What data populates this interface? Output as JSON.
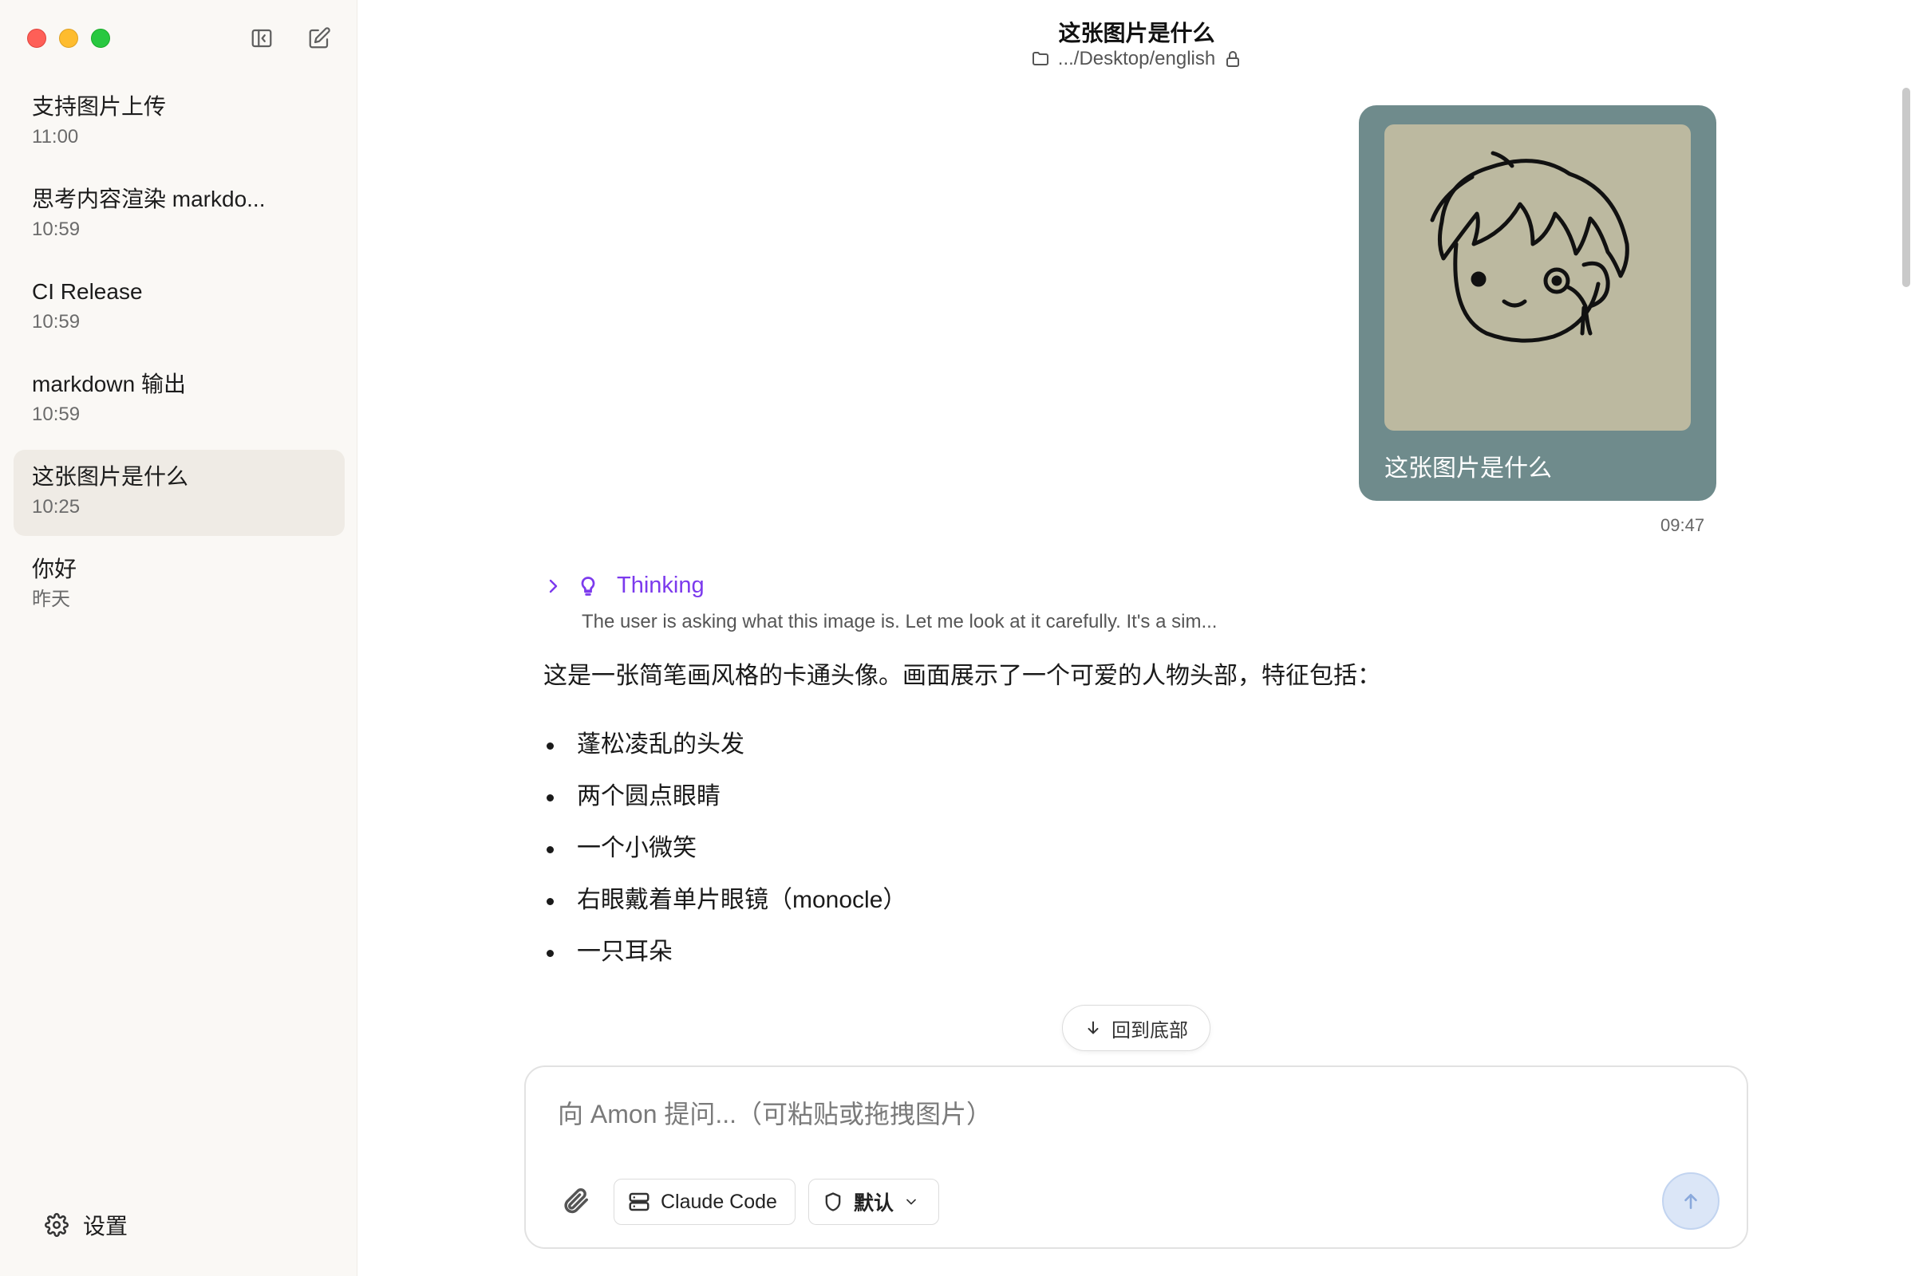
{
  "sidebar": {
    "conversations": [
      {
        "title": "支持图片上传",
        "time": "11:00"
      },
      {
        "title": "思考内容渲染 markdo...",
        "time": "10:59"
      },
      {
        "title": "CI Release",
        "time": "10:59"
      },
      {
        "title": "markdown 输出",
        "time": "10:59"
      },
      {
        "title": "这张图片是什么",
        "time": "10:25"
      },
      {
        "title": "你好",
        "time": "昨天"
      }
    ],
    "active_index": 4,
    "settings_label": "设置"
  },
  "header": {
    "title": "这张图片是什么",
    "path": ".../Desktop/english"
  },
  "chat": {
    "user_message": {
      "text": "这张图片是什么",
      "time": "09:47"
    },
    "thinking": {
      "label": "Thinking",
      "preview": "The user is asking what this image is. Let me look at it carefully. It's a sim..."
    },
    "answer": {
      "intro": "这是一张简笔画风格的卡通头像。画面展示了一个可爱的人物头部，特征包括：",
      "items": [
        "蓬松凌乱的头发",
        "两个圆点眼睛",
        "一个小微笑",
        "右眼戴着单片眼镜（monocle）",
        "一只耳朵"
      ]
    },
    "scroll_to_bottom_label": "回到底部"
  },
  "composer": {
    "placeholder": "向 Amon 提问...（可粘贴或拖拽图片）",
    "value": "",
    "model_chip": "Claude Code",
    "mode_chip": "默认"
  },
  "colors": {
    "accent_thinking": "#7c3aed",
    "bubble_bg": "#6f8b8c",
    "sidebar_bg": "#faf8f5",
    "send_bg": "#dbe6f7"
  }
}
